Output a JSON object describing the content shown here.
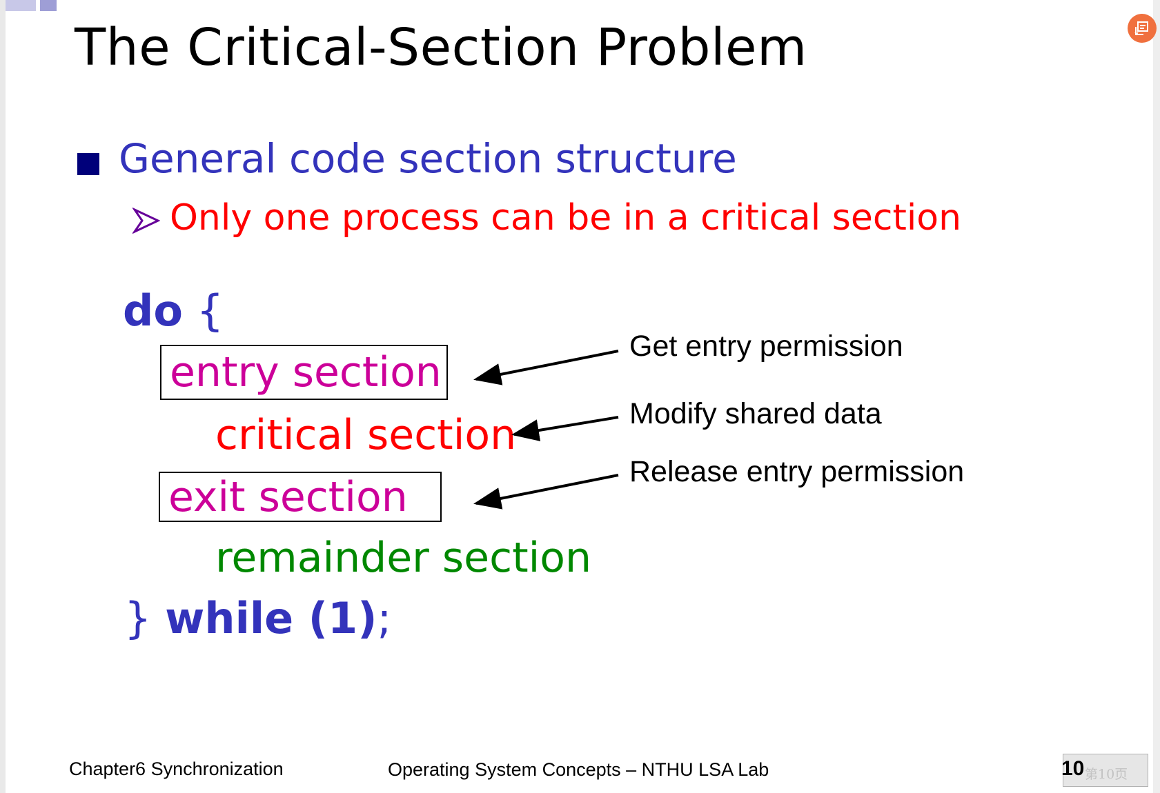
{
  "slide": {
    "title": "The Critical-Section Problem",
    "bullet": "General code section structure",
    "sub_bullet": "Only one process can be in a critical section"
  },
  "code": {
    "do_keyword": "do",
    "open_brace": " {",
    "entry": "entry section",
    "critical": "critical section",
    "exit": "exit section",
    "remainder": "remainder section",
    "close_brace": "} ",
    "while_keyword": "while (1)",
    "semicolon": ";"
  },
  "annotations": {
    "entry": "Get entry permission",
    "critical": "Modify shared data",
    "exit": "Release entry permission"
  },
  "footer": {
    "chapter": "Chapter6 Synchronization",
    "course": "Operating System Concepts – NTHU LSA Lab",
    "page_number": "10",
    "page_indicator": "第10页"
  },
  "colors": {
    "title": "#000000",
    "bullet": "#3333bb",
    "bullet_square": "#00007a",
    "sub_bullet": "#ff0000",
    "keyword": "#3333bb",
    "entry_exit": "#cc0099",
    "critical": "#ff0000",
    "remainder": "#008800",
    "note_button": "#f0703e"
  },
  "icons": {
    "bullet": "square-bullet-icon",
    "sub_bullet": "arrowhead-bullet-icon",
    "note": "note-edit-icon"
  }
}
